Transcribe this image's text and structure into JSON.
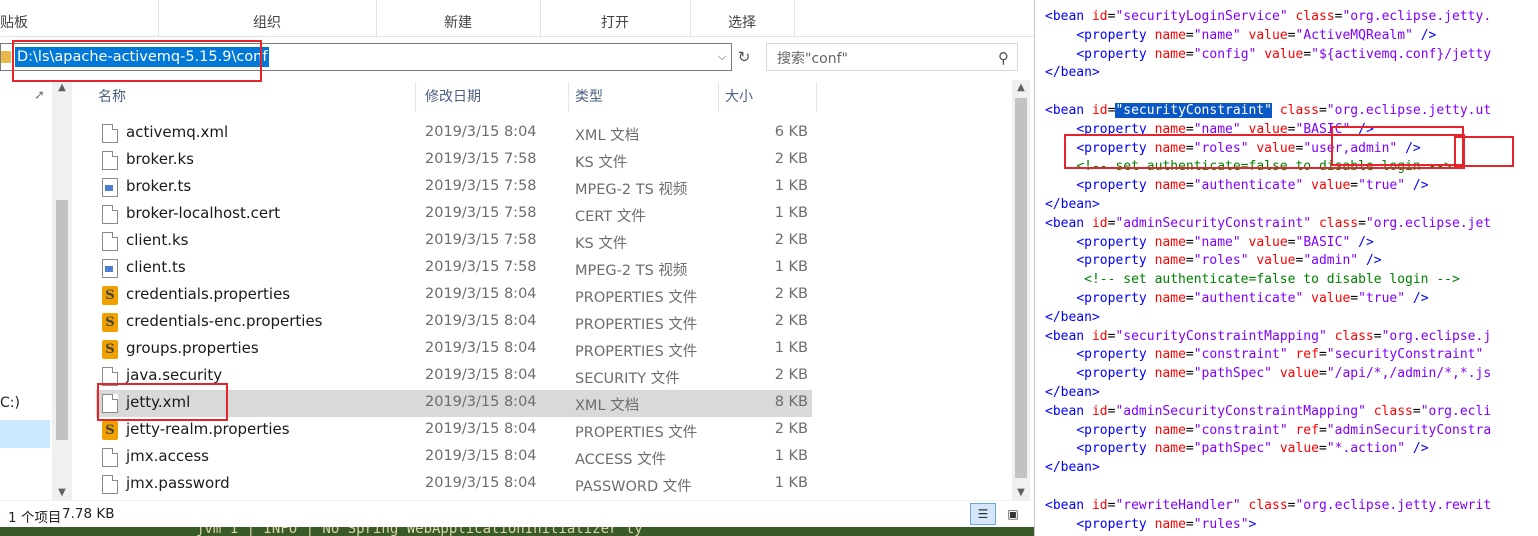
{
  "explorer": {
    "ribbon": {
      "clipboard": "贴板",
      "organize": "组织",
      "new": "新建",
      "open": "打开",
      "select": "选择"
    },
    "address": "D:\\ls\\apache-activemq-5.15.9\\conf",
    "search_placeholder": "搜索\"conf\"",
    "nav": {
      "drive_label": "C:)"
    },
    "columns": {
      "name": "名称",
      "date": "修改日期",
      "type": "类型",
      "size": "大小"
    },
    "files": [
      {
        "name": "activemq.xml",
        "date": "2019/3/15 8:04",
        "type": "XML 文档",
        "size": "6 KB",
        "icon": "doc"
      },
      {
        "name": "broker.ks",
        "date": "2019/3/15 7:58",
        "type": "KS 文件",
        "size": "2 KB",
        "icon": "doc"
      },
      {
        "name": "broker.ts",
        "date": "2019/3/15 7:58",
        "type": "MPEG-2 TS 视频",
        "size": "1 KB",
        "icon": "video"
      },
      {
        "name": "broker-localhost.cert",
        "date": "2019/3/15 7:58",
        "type": "CERT 文件",
        "size": "1 KB",
        "icon": "doc"
      },
      {
        "name": "client.ks",
        "date": "2019/3/15 7:58",
        "type": "KS 文件",
        "size": "2 KB",
        "icon": "doc"
      },
      {
        "name": "client.ts",
        "date": "2019/3/15 7:58",
        "type": "MPEG-2 TS 视频",
        "size": "1 KB",
        "icon": "video"
      },
      {
        "name": "credentials.properties",
        "date": "2019/3/15 8:04",
        "type": "PROPERTIES 文件",
        "size": "2 KB",
        "icon": "sublime"
      },
      {
        "name": "credentials-enc.properties",
        "date": "2019/3/15 8:04",
        "type": "PROPERTIES 文件",
        "size": "2 KB",
        "icon": "sublime"
      },
      {
        "name": "groups.properties",
        "date": "2019/3/15 8:04",
        "type": "PROPERTIES 文件",
        "size": "1 KB",
        "icon": "sublime"
      },
      {
        "name": "java.security",
        "date": "2019/3/15 8:04",
        "type": "SECURITY 文件",
        "size": "2 KB",
        "icon": "doc"
      },
      {
        "name": "jetty.xml",
        "date": "2019/3/15 8:04",
        "type": "XML 文档",
        "size": "8 KB",
        "icon": "doc",
        "selected": true
      },
      {
        "name": "jetty-realm.properties",
        "date": "2019/3/15 8:04",
        "type": "PROPERTIES 文件",
        "size": "2 KB",
        "icon": "sublime"
      },
      {
        "name": "jmx.access",
        "date": "2019/3/15 8:04",
        "type": "ACCESS 文件",
        "size": "1 KB",
        "icon": "doc"
      },
      {
        "name": "jmx.password",
        "date": "2019/3/15 8:04",
        "type": "PASSWORD 文件",
        "size": "1 KB",
        "icon": "doc"
      }
    ],
    "status": {
      "count": "1 个项目",
      "size": "7.78 KB"
    },
    "terminal_text": "jvm 1    |  INFO | No Spring WebApplicationInitializer ty"
  },
  "editor": {
    "lines": [
      [
        [
          "t",
          "<bean "
        ],
        [
          "a",
          "id"
        ],
        [
          "p",
          "="
        ],
        [
          "v",
          "\"securityLoginService\""
        ],
        [
          "p",
          " "
        ],
        [
          "a",
          "class"
        ],
        [
          "p",
          "="
        ],
        [
          "v",
          "\"org.eclipse.jetty."
        ]
      ],
      [
        [
          "p",
          "    "
        ],
        [
          "t",
          "<property "
        ],
        [
          "a",
          "name"
        ],
        [
          "p",
          "="
        ],
        [
          "v",
          "\"name\""
        ],
        [
          "p",
          " "
        ],
        [
          "a",
          "value"
        ],
        [
          "p",
          "="
        ],
        [
          "v",
          "\"ActiveMQRealm\""
        ],
        [
          "p",
          " "
        ],
        [
          "t",
          "/>"
        ]
      ],
      [
        [
          "p",
          "    "
        ],
        [
          "t",
          "<property "
        ],
        [
          "a",
          "name"
        ],
        [
          "p",
          "="
        ],
        [
          "v",
          "\"config\""
        ],
        [
          "p",
          " "
        ],
        [
          "a",
          "value"
        ],
        [
          "p",
          "="
        ],
        [
          "v",
          "\"${activemq.conf}/jetty"
        ]
      ],
      [
        [
          "t",
          "</bean>"
        ]
      ],
      [],
      [
        [
          "t",
          "<bean "
        ],
        [
          "a",
          "id"
        ],
        [
          "p",
          "="
        ],
        [
          "hl",
          "\"securityConstraint\""
        ],
        [
          "p",
          " "
        ],
        [
          "a",
          "class"
        ],
        [
          "p",
          "="
        ],
        [
          "v",
          "\"org.eclipse.jetty.ut"
        ]
      ],
      [
        [
          "p",
          "    "
        ],
        [
          "t",
          "<property "
        ],
        [
          "a",
          "name"
        ],
        [
          "p",
          "="
        ],
        [
          "v",
          "\"name\""
        ],
        [
          "p",
          " "
        ],
        [
          "a",
          "value"
        ],
        [
          "p",
          "="
        ],
        [
          "v",
          "\"BASIC\""
        ],
        [
          "p",
          " "
        ],
        [
          "t",
          "/>"
        ]
      ],
      [
        [
          "p",
          "    "
        ],
        [
          "t",
          "<property "
        ],
        [
          "a",
          "name"
        ],
        [
          "p",
          "="
        ],
        [
          "v",
          "\"roles\""
        ],
        [
          "p",
          " "
        ],
        [
          "a",
          "value"
        ],
        [
          "p",
          "="
        ],
        [
          "v",
          "\"user,admin\""
        ],
        [
          "p",
          " "
        ],
        [
          "t",
          "/>"
        ]
      ],
      [
        [
          "p",
          "    "
        ],
        [
          "c",
          "<!-- set authenticate=false to disable login -->"
        ]
      ],
      [
        [
          "p",
          "    "
        ],
        [
          "t",
          "<property "
        ],
        [
          "a",
          "name"
        ],
        [
          "p",
          "="
        ],
        [
          "v",
          "\"authenticate\""
        ],
        [
          "p",
          " "
        ],
        [
          "a",
          "value"
        ],
        [
          "p",
          "="
        ],
        [
          "v",
          "\"true\""
        ],
        [
          "p",
          " "
        ],
        [
          "t",
          "/>"
        ]
      ],
      [
        [
          "t",
          "</bean>"
        ]
      ],
      [
        [
          "t",
          "<bean "
        ],
        [
          "a",
          "id"
        ],
        [
          "p",
          "="
        ],
        [
          "v",
          "\"adminSecurityConstraint\""
        ],
        [
          "p",
          " "
        ],
        [
          "a",
          "class"
        ],
        [
          "p",
          "="
        ],
        [
          "v",
          "\"org.eclipse.jet"
        ]
      ],
      [
        [
          "p",
          "    "
        ],
        [
          "t",
          "<property "
        ],
        [
          "a",
          "name"
        ],
        [
          "p",
          "="
        ],
        [
          "v",
          "\"name\""
        ],
        [
          "p",
          " "
        ],
        [
          "a",
          "value"
        ],
        [
          "p",
          "="
        ],
        [
          "v",
          "\"BASIC\""
        ],
        [
          "p",
          " "
        ],
        [
          "t",
          "/>"
        ]
      ],
      [
        [
          "p",
          "    "
        ],
        [
          "t",
          "<property "
        ],
        [
          "a",
          "name"
        ],
        [
          "p",
          "="
        ],
        [
          "v",
          "\"roles\""
        ],
        [
          "p",
          " "
        ],
        [
          "a",
          "value"
        ],
        [
          "p",
          "="
        ],
        [
          "v",
          "\"admin\""
        ],
        [
          "p",
          " "
        ],
        [
          "t",
          "/>"
        ]
      ],
      [
        [
          "p",
          "     "
        ],
        [
          "c",
          "<!-- set authenticate=false to disable login -->"
        ]
      ],
      [
        [
          "p",
          "    "
        ],
        [
          "t",
          "<property "
        ],
        [
          "a",
          "name"
        ],
        [
          "p",
          "="
        ],
        [
          "v",
          "\"authenticate\""
        ],
        [
          "p",
          " "
        ],
        [
          "a",
          "value"
        ],
        [
          "p",
          "="
        ],
        [
          "v",
          "\"true\""
        ],
        [
          "p",
          " "
        ],
        [
          "t",
          "/>"
        ]
      ],
      [
        [
          "t",
          "</bean>"
        ]
      ],
      [
        [
          "t",
          "<bean "
        ],
        [
          "a",
          "id"
        ],
        [
          "p",
          "="
        ],
        [
          "v",
          "\"securityConstraintMapping\""
        ],
        [
          "p",
          " "
        ],
        [
          "a",
          "class"
        ],
        [
          "p",
          "="
        ],
        [
          "v",
          "\"org.eclipse.j"
        ]
      ],
      [
        [
          "p",
          "    "
        ],
        [
          "t",
          "<property "
        ],
        [
          "a",
          "name"
        ],
        [
          "p",
          "="
        ],
        [
          "v",
          "\"constraint\""
        ],
        [
          "p",
          " "
        ],
        [
          "a",
          "ref"
        ],
        [
          "p",
          "="
        ],
        [
          "v",
          "\"securityConstraint\""
        ]
      ],
      [
        [
          "p",
          "    "
        ],
        [
          "t",
          "<property "
        ],
        [
          "a",
          "name"
        ],
        [
          "p",
          "="
        ],
        [
          "v",
          "\"pathSpec\""
        ],
        [
          "p",
          " "
        ],
        [
          "a",
          "value"
        ],
        [
          "p",
          "="
        ],
        [
          "v",
          "\"/api/*,/admin/*,*.js"
        ]
      ],
      [
        [
          "t",
          "</bean>"
        ]
      ],
      [
        [
          "t",
          "<bean "
        ],
        [
          "a",
          "id"
        ],
        [
          "p",
          "="
        ],
        [
          "v",
          "\"adminSecurityConstraintMapping\""
        ],
        [
          "p",
          " "
        ],
        [
          "a",
          "class"
        ],
        [
          "p",
          "="
        ],
        [
          "v",
          "\"org.ecli"
        ]
      ],
      [
        [
          "p",
          "    "
        ],
        [
          "t",
          "<property "
        ],
        [
          "a",
          "name"
        ],
        [
          "p",
          "="
        ],
        [
          "v",
          "\"constraint\""
        ],
        [
          "p",
          " "
        ],
        [
          "a",
          "ref"
        ],
        [
          "p",
          "="
        ],
        [
          "v",
          "\"adminSecurityConstra"
        ]
      ],
      [
        [
          "p",
          "    "
        ],
        [
          "t",
          "<property "
        ],
        [
          "a",
          "name"
        ],
        [
          "p",
          "="
        ],
        [
          "v",
          "\"pathSpec\""
        ],
        [
          "p",
          " "
        ],
        [
          "a",
          "value"
        ],
        [
          "p",
          "="
        ],
        [
          "v",
          "\"*.action\""
        ],
        [
          "p",
          " "
        ],
        [
          "t",
          "/>"
        ]
      ],
      [
        [
          "t",
          "</bean>"
        ]
      ],
      [],
      [
        [
          "t",
          "<bean "
        ],
        [
          "a",
          "id"
        ],
        [
          "p",
          "="
        ],
        [
          "v",
          "\"rewriteHandler\""
        ],
        [
          "p",
          " "
        ],
        [
          "a",
          "class"
        ],
        [
          "p",
          "="
        ],
        [
          "v",
          "\"org.eclipse.jetty.rewrit"
        ]
      ],
      [
        [
          "p",
          "    "
        ],
        [
          "t",
          "<property "
        ],
        [
          "a",
          "name"
        ],
        [
          "p",
          "="
        ],
        [
          "v",
          "\"rules\""
        ],
        [
          "t",
          ">"
        ]
      ]
    ]
  }
}
